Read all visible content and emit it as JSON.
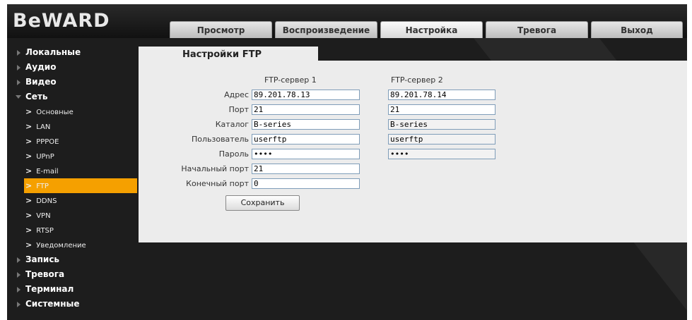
{
  "logo": "BeWARD",
  "tabs": [
    "Просмотр",
    "Воспроизведение",
    "Настройка",
    "Тревога",
    "Выход"
  ],
  "active_tab": "Настройка",
  "sidebar": {
    "top_items": [
      "Локальные",
      "Аудио",
      "Видео",
      "Сеть"
    ],
    "sub_items": [
      "Основные",
      "LAN",
      "PPPOE",
      "UPnP",
      "E-mail",
      "FTP",
      "DDNS",
      "VPN",
      "RTSP",
      "Уведомление"
    ],
    "active_sub": "FTP",
    "bottom_items": [
      "Запись",
      "Тревога",
      "Терминал",
      "Системные"
    ]
  },
  "section_title": "Настройки FTP",
  "columns": {
    "server1": "FTP-сервер 1",
    "server2": "FTP-сервер 2"
  },
  "fields": {
    "address": {
      "label": "Адрес",
      "v1": "89.201.78.13",
      "v2": "89.201.78.14"
    },
    "port": {
      "label": "Порт",
      "v1": "21",
      "v2": "21"
    },
    "catalog": {
      "label": "Каталог",
      "v1": "B-series",
      "v2": "B-series"
    },
    "user": {
      "label": "Пользователь",
      "v1": "userftp",
      "v2": "userftp"
    },
    "password": {
      "label": "Пароль",
      "v1": "••••",
      "v2": "••••"
    },
    "start_port": {
      "label": "Начальный порт",
      "v1": "21"
    },
    "end_port": {
      "label": "Конечный порт",
      "v1": "0"
    }
  },
  "save_label": "Сохранить"
}
